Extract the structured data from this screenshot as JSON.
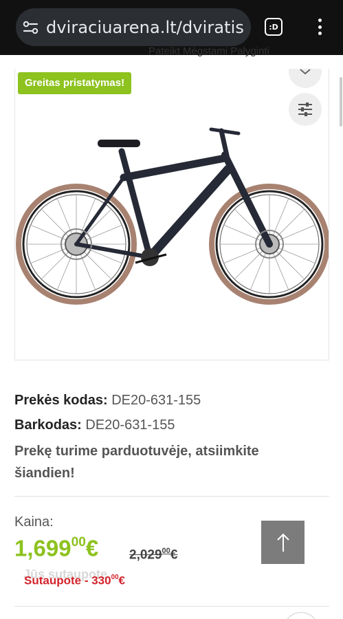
{
  "browser": {
    "url": "dviraciuarena.lt/dviratis",
    "tab_button_label": ":D",
    "icons": [
      "site-info-icon",
      "tab-switcher-icon",
      "more-vert-icon"
    ]
  },
  "breadcrumb_peek": "Pateikt   Mėgstami   Palyginti",
  "product": {
    "badge": "Greitas pristatymas!",
    "image_icons": [
      "wishlist-heart-icon",
      "compare-sliders-icon"
    ],
    "code_label": "Prekės kodas:",
    "code_value": "DE20-631-155",
    "barcode_label": "Barkodas:",
    "barcode_value": "DE20-631-155",
    "stock_text": "Prekę turime parduotuvėje, atsiimkite šiandien!"
  },
  "price": {
    "label": "Kaina:",
    "current_main": "1,699",
    "current_cents": "00",
    "old_main": "2,029",
    "old_cents": "00",
    "currency": "€",
    "saving_prefix": "Sutaupote - 330",
    "saving_cents": "00",
    "saving_currency": "€",
    "ghost_text": "Jūs sutaupote"
  },
  "colors": {
    "accent_green": "#8dc21f",
    "saving_red": "#d3222a",
    "browser_bar": "#111111"
  },
  "scroll_top_icon": "arrow-up-icon"
}
